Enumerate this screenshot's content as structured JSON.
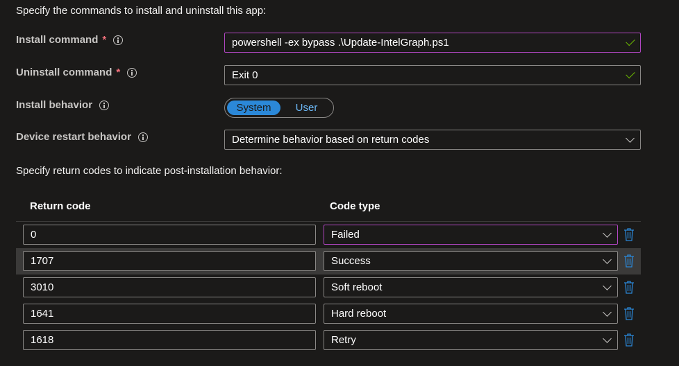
{
  "intro_text": "Specify the commands to install and uninstall this app:",
  "fields": {
    "install_command": {
      "label": "Install command",
      "required_mark": "*",
      "value": "powershell -ex bypass .\\Update-IntelGraph.ps1"
    },
    "uninstall_command": {
      "label": "Uninstall command",
      "required_mark": "*",
      "value": "Exit 0"
    },
    "install_behavior": {
      "label": "Install behavior",
      "options": [
        "System",
        "User"
      ],
      "selected": "System"
    },
    "restart_behavior": {
      "label": "Device restart behavior",
      "value": "Determine behavior based on return codes"
    }
  },
  "return_codes": {
    "section_text": "Specify return codes to indicate post-installation behavior:",
    "headers": {
      "code": "Return code",
      "type": "Code type"
    },
    "rows": [
      {
        "code": "0",
        "type": "Failed"
      },
      {
        "code": "1707",
        "type": "Success"
      },
      {
        "code": "3010",
        "type": "Soft reboot"
      },
      {
        "code": "1641",
        "type": "Hard reboot"
      },
      {
        "code": "1618",
        "type": "Retry"
      }
    ]
  },
  "colors": {
    "background": "#1b1a19",
    "focus_border": "#b146c2",
    "toggle_accent": "#2b88d8",
    "valid_check": "#6bb700",
    "required_asterisk": "#f1707b",
    "delete_icon": "#2b88d8"
  },
  "icons": {
    "info": "info-icon",
    "valid": "checkmark-icon",
    "dropdown": "chevron-down-icon",
    "delete": "trash-icon"
  }
}
